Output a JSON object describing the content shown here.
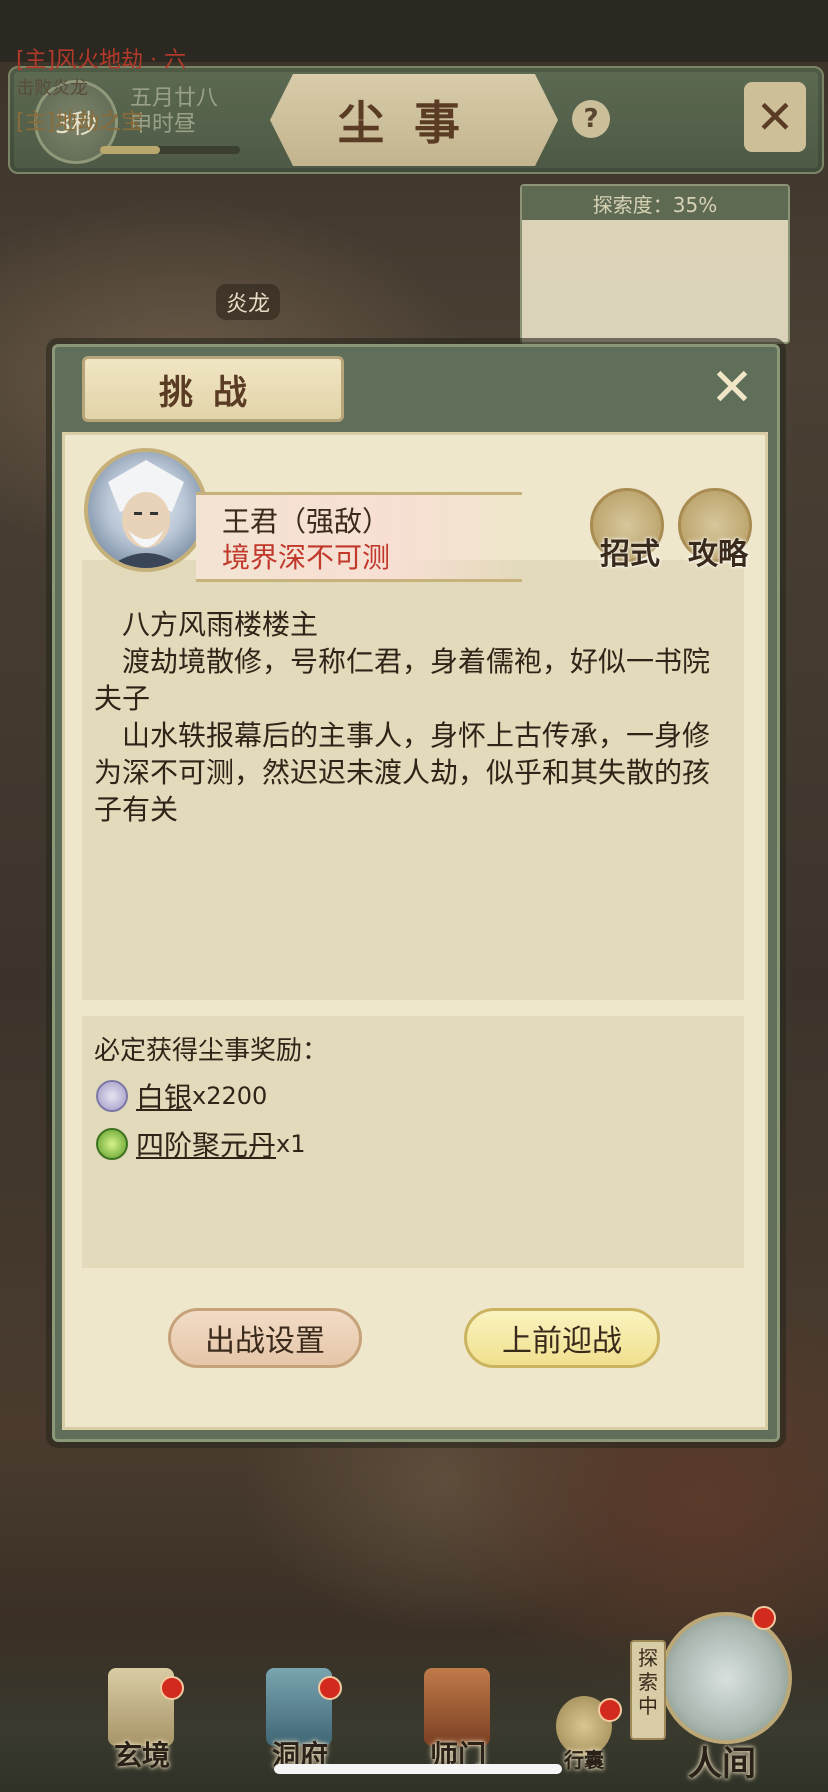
{
  "header": {
    "timer": "3秒",
    "date_line1": "五月廿八",
    "date_line2": "申时昼",
    "title": "尘事",
    "help": "?"
  },
  "quest": {
    "explore_label": "探索度：35%",
    "row1": "[主]风火地劫 · 六",
    "row2": "击败炎龙",
    "row3": "[主]地劫之宝"
  },
  "map": {
    "label": "炎龙"
  },
  "dialog": {
    "title": "挑战",
    "boss_name": "王君（强敌）",
    "boss_realm": "境界深不可测",
    "skill_label": "招式",
    "guide_label": "攻略",
    "description": [
      "八方风雨楼楼主",
      "渡劫境散修，号称仁君，身着儒袍，好似一书院夫子",
      "山水轶报幕后的主事人，身怀上古传承，一身修为深不可测，然迟迟未渡人劫，似乎和其失散的孩子有关"
    ],
    "reward_title": "必定获得尘事奖励：",
    "rewards": [
      {
        "name": "白银",
        "qty": "x2200",
        "icon": "silver-coin-icon"
      },
      {
        "name": "四阶聚元丹",
        "qty": "x1",
        "icon": "green-pill-icon"
      }
    ],
    "setup_button": "出战设置",
    "fight_button": "上前迎战"
  },
  "bottom_nav": {
    "items": [
      "玄境",
      "洞府",
      "师门"
    ],
    "bag": "行囊",
    "explore": "探索中",
    "human": "人间"
  },
  "colors": {
    "panel_green": "#5f6f59",
    "paper": "#efe7cb",
    "realm_red": "#c0392b",
    "fight_yellow": "#f0e08e"
  }
}
